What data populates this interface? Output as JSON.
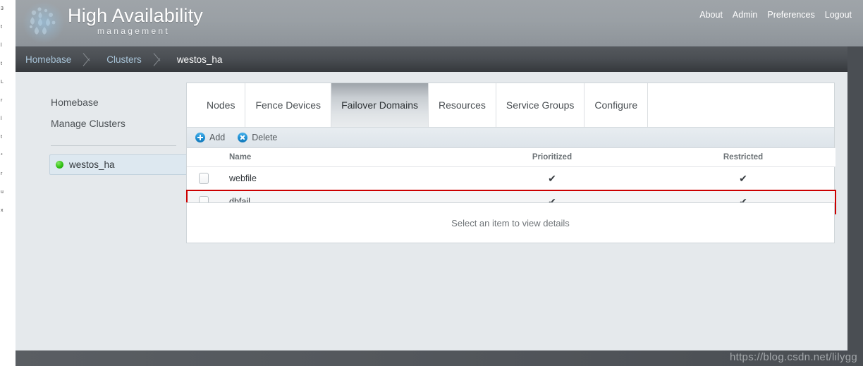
{
  "header": {
    "brand_title": "High Availability",
    "brand_sub": "management",
    "logo_icon": "cluster-dots-logo",
    "nav": [
      {
        "label": "About"
      },
      {
        "label": "Admin"
      },
      {
        "label": "Preferences"
      },
      {
        "label": "Logout"
      }
    ]
  },
  "breadcrumb": [
    {
      "label": "Homebase",
      "current": false
    },
    {
      "label": "Clusters",
      "current": false
    },
    {
      "label": "westos_ha",
      "current": true
    }
  ],
  "sidebar": {
    "links": [
      {
        "label": "Homebase"
      },
      {
        "label": "Manage Clusters"
      }
    ],
    "cluster": {
      "label": "westos_ha",
      "status_icon": "green-status-dot",
      "status_color": "#31c113"
    }
  },
  "tabs": [
    {
      "label": "Nodes",
      "active": false
    },
    {
      "label": "Fence Devices",
      "active": false
    },
    {
      "label": "Failover Domains",
      "active": true
    },
    {
      "label": "Resources",
      "active": false
    },
    {
      "label": "Service Groups",
      "active": false
    },
    {
      "label": "Configure",
      "active": false
    }
  ],
  "toolbar": {
    "add_label": "Add",
    "add_icon": "plus-circle-icon",
    "delete_label": "Delete",
    "delete_icon": "x-circle-icon"
  },
  "table": {
    "columns": [
      "",
      "Name",
      "Prioritized",
      "Restricted"
    ],
    "check_glyph": "✔",
    "rows": [
      {
        "name": "webfile",
        "prioritized": "✔",
        "restricted": "✔",
        "checked": false,
        "highlighted": false
      },
      {
        "name": "dbfail",
        "prioritized": "✔",
        "restricted": "✔",
        "checked": false,
        "highlighted": true
      }
    ]
  },
  "details": {
    "placeholder": "Select an item to view details"
  },
  "annotation": {
    "color": "#cc0000"
  },
  "watermark": {
    "text": "https://blog.csdn.net/lilygg"
  },
  "edge_fragments": [
    "3",
    "t",
    "l",
    "t",
    "L",
    "r",
    "l",
    "t",
    "*",
    "r",
    "u",
    "x"
  ]
}
